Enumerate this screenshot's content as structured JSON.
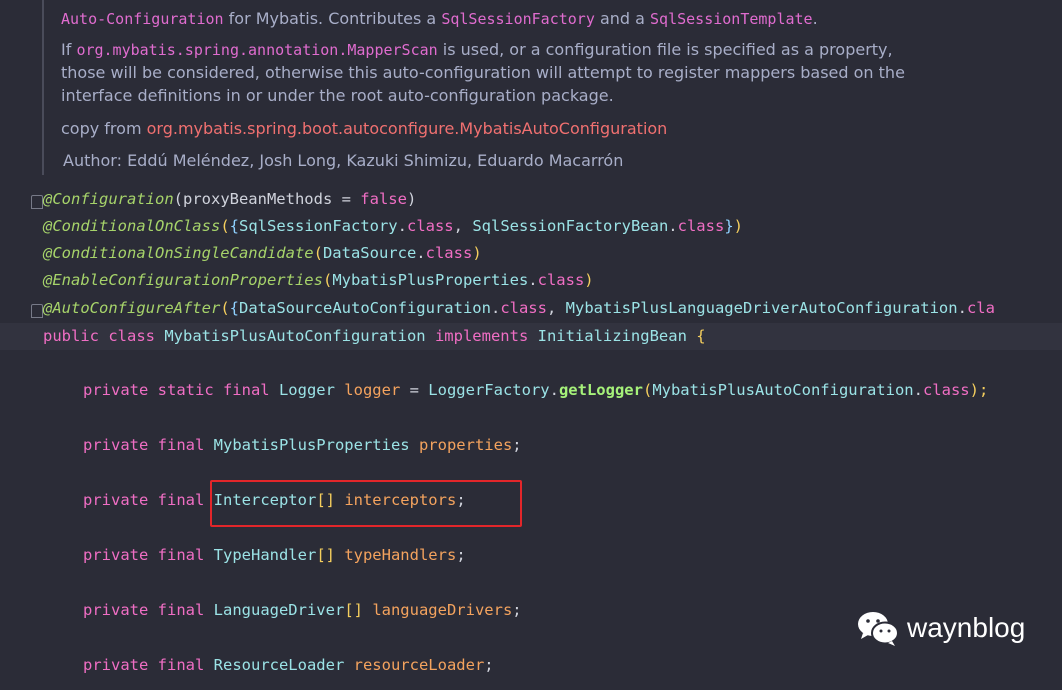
{
  "doc": {
    "line1": {
      "a": "Auto-Configuration",
      "b": " for Mybatis. Contributes a ",
      "c": "SqlSessionFactory",
      "d": " and a ",
      "e": "SqlSessionTemplate",
      "f": "."
    },
    "line2": {
      "a": "If ",
      "b": "org.mybatis.spring.annotation.MapperScan",
      "c": " is used, or a configuration file is specified as a property,"
    },
    "line3": "those will be considered, otherwise this auto-configuration will attempt to register mappers based on the",
    "line4": "interface definitions in or under the root auto-configuration package.",
    "copy_from": {
      "label": "copy from ",
      "link": "org.mybatis.spring.boot.autoconfigure.MybatisAutoConfiguration"
    },
    "author": {
      "label": "Author: ",
      "names": "Eddú Meléndez, Josh Long, Kazuki Shimizu, Eduardo Macarrón"
    }
  },
  "code": {
    "l1": {
      "ann": "@Configuration",
      "p1": "(proxyBeanMethods = ",
      "kw": "false",
      "p2": ")"
    },
    "l2": {
      "ann": "@ConditionalOnClass",
      "p1": "(",
      "b1": "{",
      "t1": "SqlSessionFactory",
      "d1": ".",
      "k1": "class",
      "c1": ", ",
      "t2": "SqlSessionFactoryBean",
      "d2": ".",
      "k2": "class",
      "b2": "}",
      "p2": ")"
    },
    "l3": {
      "ann": "@ConditionalOnSingleCandidate",
      "p1": "(",
      "t1": "DataSource",
      "d1": ".",
      "k1": "class",
      "p2": ")"
    },
    "l4": {
      "ann": "@EnableConfigurationProperties",
      "p1": "(",
      "t1": "MybatisPlusProperties",
      "d1": ".",
      "k1": "class",
      "p2": ")"
    },
    "l5": {
      "ann": "@AutoConfigureAfter",
      "p1": "(",
      "b1": "{",
      "t1": "DataSourceAutoConfiguration",
      "d1": ".",
      "k1": "class",
      "c1": ", ",
      "t2": "MybatisPlusLanguageDriverAutoConfiguration",
      "d2": ".",
      "k2": "cla"
    },
    "l6": {
      "k1": "public class ",
      "t1": "MybatisPlusAutoConfiguration",
      "k2": " implements ",
      "t2": "InitializingBean",
      "b1": " {"
    },
    "l7": {
      "k1": "private static final ",
      "t1": "Logger",
      "f1": " logger",
      "p1": " = ",
      "t2": "LoggerFactory",
      "d1": ".",
      "m1": "getLogger",
      "p2": "(",
      "t3": "MybatisPlusAutoConfiguration",
      "d2": ".",
      "k2": "class",
      "p3": ");"
    },
    "l8": {
      "k1": "private final ",
      "t1": "MybatisPlusProperties",
      "f1": " properties",
      "p1": ";"
    },
    "l9": {
      "k1": "private final ",
      "t1": "Interceptor",
      "b1": "[]",
      "f1": " interceptors",
      "p1": ";"
    },
    "l10": {
      "k1": "private final ",
      "t1": "TypeHandler",
      "b1": "[]",
      "f1": " typeHandlers",
      "p1": ";"
    },
    "l11": {
      "k1": "private final ",
      "t1": "LanguageDriver",
      "b1": "[]",
      "f1": " languageDrivers",
      "p1": ";"
    },
    "l12": {
      "k1": "private final ",
      "t1": "ResourceLoader",
      "f1": " resourceLoader",
      "p1": ";"
    }
  },
  "watermark": {
    "text": "waynblog",
    "icon": "wechat-icon"
  },
  "colors": {
    "background": "#2b2c37",
    "keyword": "#f06ec4",
    "annotation": "#a6d36a",
    "highlight_box": "#e3262a"
  }
}
